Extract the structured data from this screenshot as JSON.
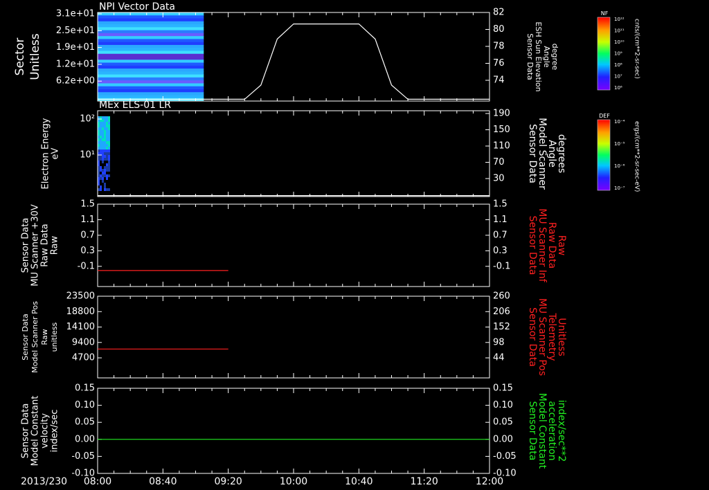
{
  "date_label": "2013/230",
  "time_axis": {
    "start": "08:00",
    "end": "12:00",
    "tick_labels": [
      "08:00",
      "08:40",
      "09:20",
      "10:00",
      "10:40",
      "11:20",
      "12:00"
    ]
  },
  "chart_data": [
    {
      "type": "heatmap",
      "title": "NPI Vector Data",
      "ylabel_left": [
        "Sector",
        "Unitless"
      ],
      "ylabel_right": [
        "Sensor Data",
        "ESH Sun Elevation",
        "Angle",
        "degree"
      ],
      "left_tick_labels": [
        "3.1e+01",
        "2.5e+01",
        "1.9e+01",
        "1.2e+01",
        "6.2e+00"
      ],
      "right_tick_labels": [
        "82",
        "80",
        "78",
        "76",
        "74"
      ],
      "ylim_left": [
        0,
        31
      ],
      "ylim_right": [
        72,
        82
      ],
      "spectrogram_time_range": [
        "08:00",
        "09:05"
      ],
      "line_series": {
        "x": [
          "08:00",
          "09:30",
          "09:40",
          "09:50",
          "10:00",
          "10:40",
          "10:50",
          "11:00",
          "11:10",
          "12:00"
        ],
        "y": [
          72.2,
          72.2,
          73.8,
          79.0,
          80.7,
          80.7,
          79.0,
          73.8,
          72.2,
          72.2
        ]
      },
      "colorbar": {
        "label": "NF",
        "units": "cnts/(cm**2-sr-sec)",
        "tick_labels": [
          "10¹²",
          "10¹¹",
          "10¹⁰",
          "10⁹",
          "10⁸",
          "10⁷",
          "10⁶"
        ]
      }
    },
    {
      "type": "heatmap",
      "title": "MEx ELS-01 LR",
      "ylabel_left": [
        "Electron Energy",
        "eV"
      ],
      "ylabel_right": [
        "Sensor Data",
        "Model Scanner",
        "Angle",
        "degrees"
      ],
      "left_tick_labels": [
        "10²",
        "10¹"
      ],
      "right_tick_labels": [
        "190",
        "150",
        "110",
        "70",
        "30"
      ],
      "yscale_left": "log",
      "ylim_right": [
        10,
        190
      ],
      "spectrogram_time_range": [
        "08:00",
        "08:07"
      ],
      "line_series": {
        "x": [
          "08:00",
          "12:00"
        ],
        "y": [
          12,
          12
        ]
      },
      "colorbar": {
        "label": "DEF",
        "units": "ergs/(cm**2-sr-sec-eV)",
        "tick_labels": [
          "10⁻⁴",
          "10⁻⁵",
          "10⁻⁶",
          "10⁻⁷"
        ]
      }
    },
    {
      "type": "line",
      "ylabel_left": [
        "Sensor Data",
        "MU Scanner +30V",
        "Raw Data",
        "Raw"
      ],
      "ylabel_right": [
        "Sensor Data",
        "MU Scanner Inf",
        "Raw Data",
        "Raw"
      ],
      "ylabel_right_color": "#ff2020",
      "left_tick_labels": [
        "1.5",
        "1.1",
        "0.7",
        "0.3",
        "-0.1"
      ],
      "right_tick_labels": [
        "1.5",
        "1.1",
        "0.7",
        "0.3",
        "-0.1"
      ],
      "ylim": [
        -0.3,
        1.5
      ],
      "series": [
        {
          "color": "#ff2020",
          "x": [
            "08:00",
            "09:20"
          ],
          "y": [
            0.05,
            0.05
          ]
        }
      ]
    },
    {
      "type": "line",
      "ylabel_left": [
        "Sensor Data",
        "Model Scanner Pos",
        "Raw",
        "unitless"
      ],
      "ylabel_right": [
        "Sensor Data",
        "MU Scanner Pos",
        "Telemetry",
        "Unitless"
      ],
      "ylabel_right_color": "#ff2020",
      "left_tick_labels": [
        "23500",
        "18800",
        "14100",
        "9400",
        "4700"
      ],
      "right_tick_labels": [
        "260",
        "206",
        "152",
        "98",
        "44"
      ],
      "ylim": [
        0,
        23500
      ],
      "series": [
        {
          "color": "#ff2020",
          "x": [
            "08:00",
            "09:20"
          ],
          "y": [
            8300,
            8300
          ]
        }
      ]
    },
    {
      "type": "line",
      "ylabel_left": [
        "Sensor Data",
        "Model Constant",
        "velocity",
        "index/sec"
      ],
      "ylabel_right": [
        "Sensor Data",
        "Model Constant",
        "acceleration",
        "index/sec**2"
      ],
      "ylabel_right_color": "#22ee22",
      "left_tick_labels": [
        "0.15",
        "0.10",
        "0.05",
        "0.00",
        "-0.05",
        "-0.10"
      ],
      "right_tick_labels": [
        "0.15",
        "0.10",
        "0.05",
        "0.00",
        "-0.05",
        "-0.10"
      ],
      "ylim": [
        -0.1,
        0.15
      ],
      "series": [
        {
          "color": "#22ee22",
          "x": [
            "08:00",
            "12:00"
          ],
          "y": [
            0.0,
            0.0
          ]
        }
      ]
    }
  ]
}
